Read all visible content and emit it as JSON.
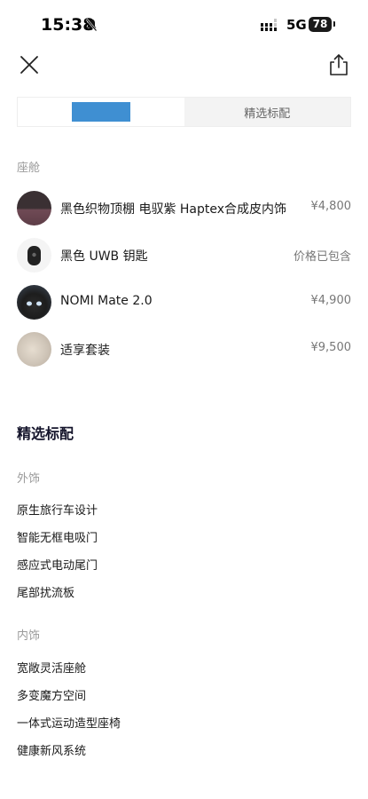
{
  "status_bar": {
    "time": "15:38",
    "network": "5G",
    "battery": "78"
  },
  "tabs": [
    {
      "label": "",
      "redacted": true,
      "active": true
    },
    {
      "label": "精选标配",
      "active": false
    }
  ],
  "cabin": {
    "label": "座舱",
    "items": [
      {
        "name": "黑色织物顶棚 电驭紫 Haptex合成皮内饰",
        "price": "¥4,800",
        "thumb": "fabric-thumbnail"
      },
      {
        "name": "黑色 UWB 钥匙",
        "price": "价格已包含",
        "thumb": "key-thumbnail"
      },
      {
        "name": "NOMI Mate 2.0",
        "price": "¥4,900",
        "thumb": "nomi-thumbnail"
      },
      {
        "name": "适享套装",
        "price": "¥9,500",
        "thumb": "comfort-thumbnail"
      }
    ]
  },
  "featured": {
    "title": "精选标配",
    "exterior": {
      "label": "外饰",
      "items": [
        "原生旅行车设计",
        "智能无框电吸门",
        "感应式电动尾门",
        "尾部扰流板"
      ]
    },
    "interior": {
      "label": "内饰",
      "items": [
        "宽敞灵活座舱",
        "多变魔方空间",
        "一体式运动造型座椅",
        "健康新风系统"
      ]
    }
  },
  "icons": {
    "close": "close-icon",
    "share": "share-icon",
    "mute": "bell-slash-icon",
    "signal": "signal-icon"
  },
  "colors": {
    "redaction": "#3f8fd2",
    "section_label": "#9a9a9a",
    "title": "#14142b"
  }
}
